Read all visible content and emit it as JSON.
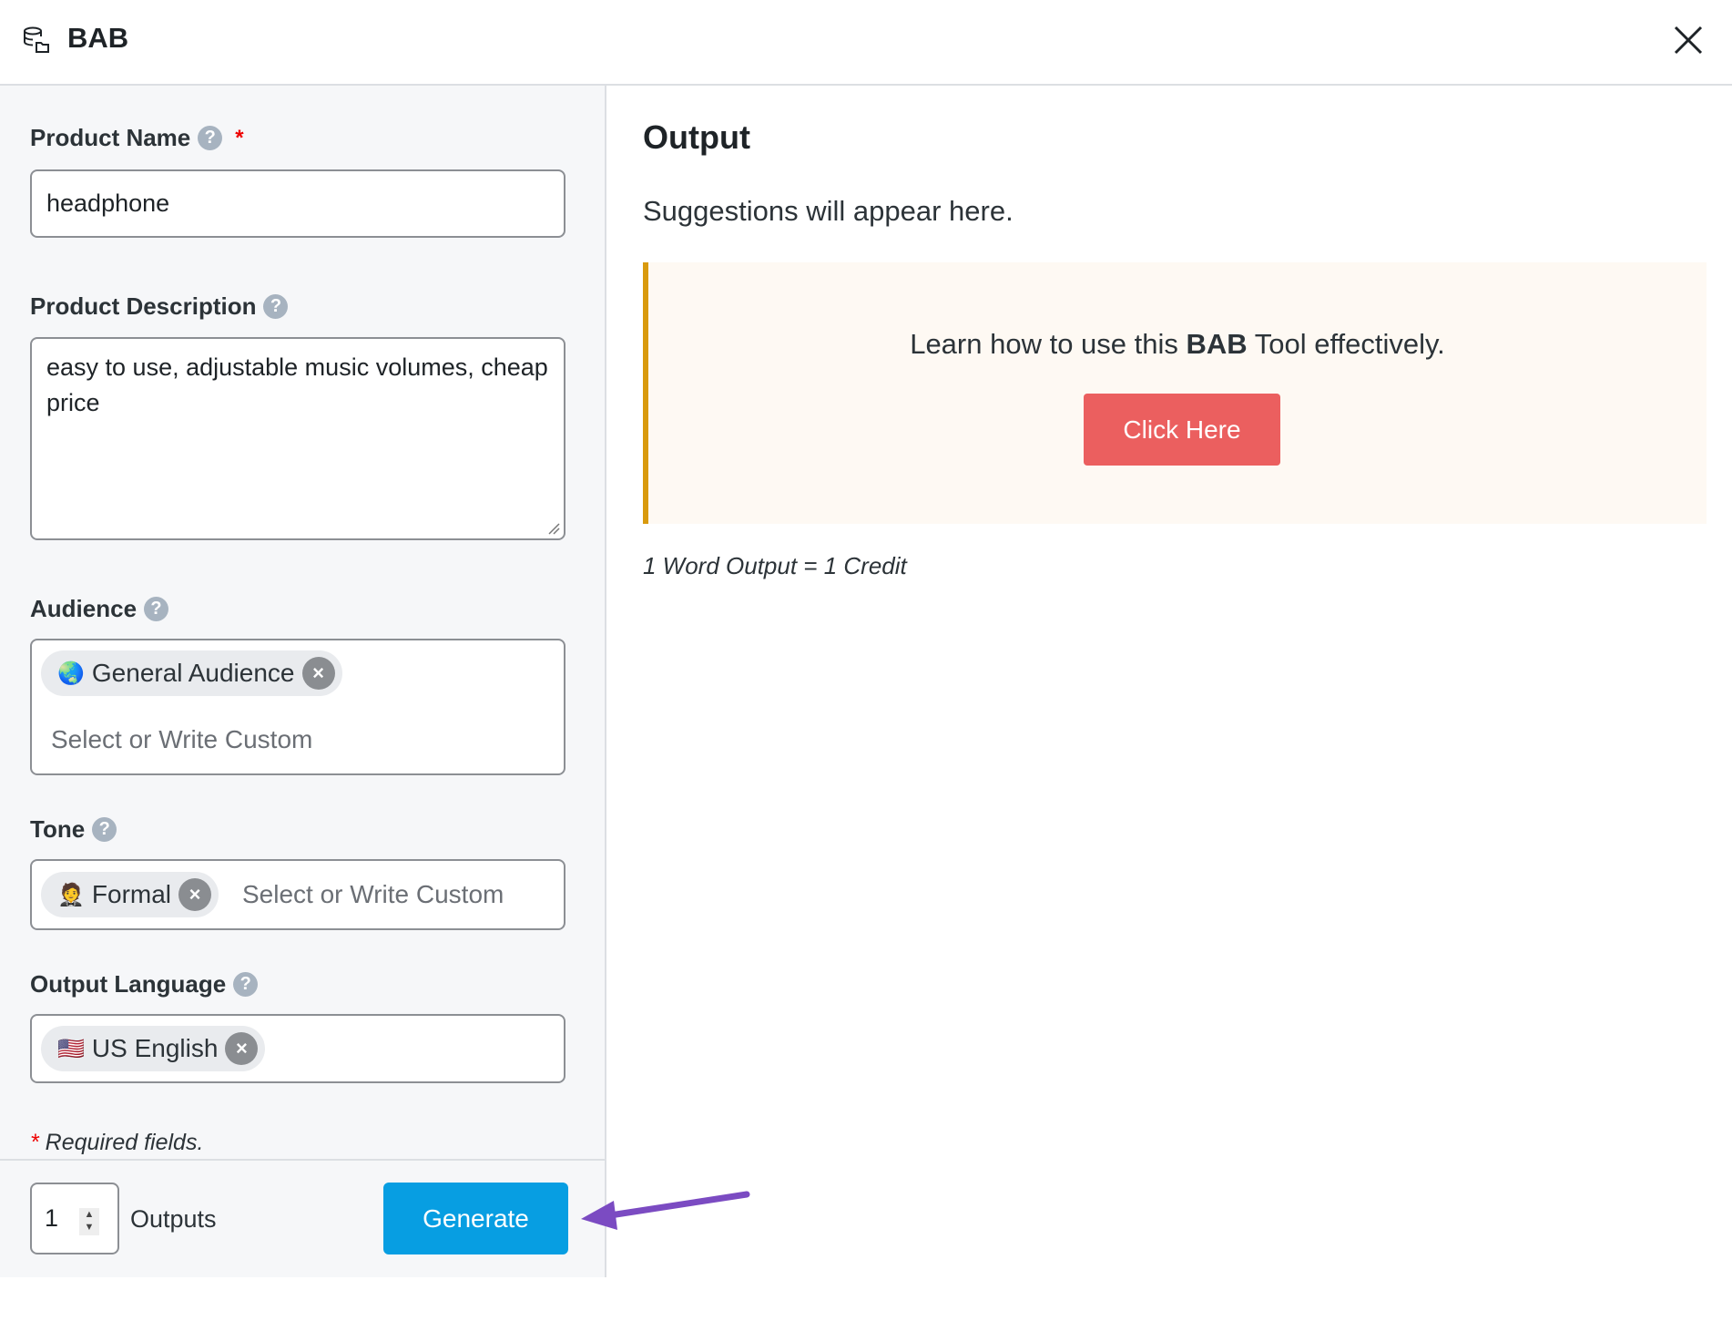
{
  "header": {
    "title": "BAB",
    "logo_icon": "database-folder-icon",
    "close_icon": "close-icon"
  },
  "form": {
    "product_name": {
      "label": "Product Name",
      "required_mark": "*",
      "value": "headphone"
    },
    "product_description": {
      "label": "Product Description",
      "value": "easy to use, adjustable music volumes, cheap price"
    },
    "audience": {
      "label": "Audience",
      "chips": [
        {
          "emoji": "🌏",
          "label": "General Audience"
        }
      ],
      "placeholder": "Select or Write Custom"
    },
    "tone": {
      "label": "Tone",
      "chips": [
        {
          "emoji": "🤵",
          "label": "Formal"
        }
      ],
      "placeholder": "Select or Write Custom"
    },
    "output_language": {
      "label": "Output Language",
      "chips": [
        {
          "emoji": "🇺🇸",
          "label": "US English"
        }
      ]
    },
    "help_glyph": "?",
    "chip_remove_glyph": "×",
    "required_note": {
      "star": "*",
      "text": " Required fields."
    }
  },
  "footer": {
    "outputs_value": "1",
    "outputs_label": "Outputs",
    "generate_label": "Generate"
  },
  "output": {
    "title": "Output",
    "placeholder": "Suggestions will appear here.",
    "callout": {
      "text_before": "Learn how to use this ",
      "text_bold": "BAB",
      "text_after": " Tool effectively.",
      "button_label": "Click Here"
    },
    "credit_note": "1 Word Output = 1 Credit"
  },
  "colors": {
    "primary": "#079ee2",
    "callout_button": "#eb5f5f",
    "callout_border": "#d99a0e",
    "annotation_arrow": "#7b4bc2"
  }
}
